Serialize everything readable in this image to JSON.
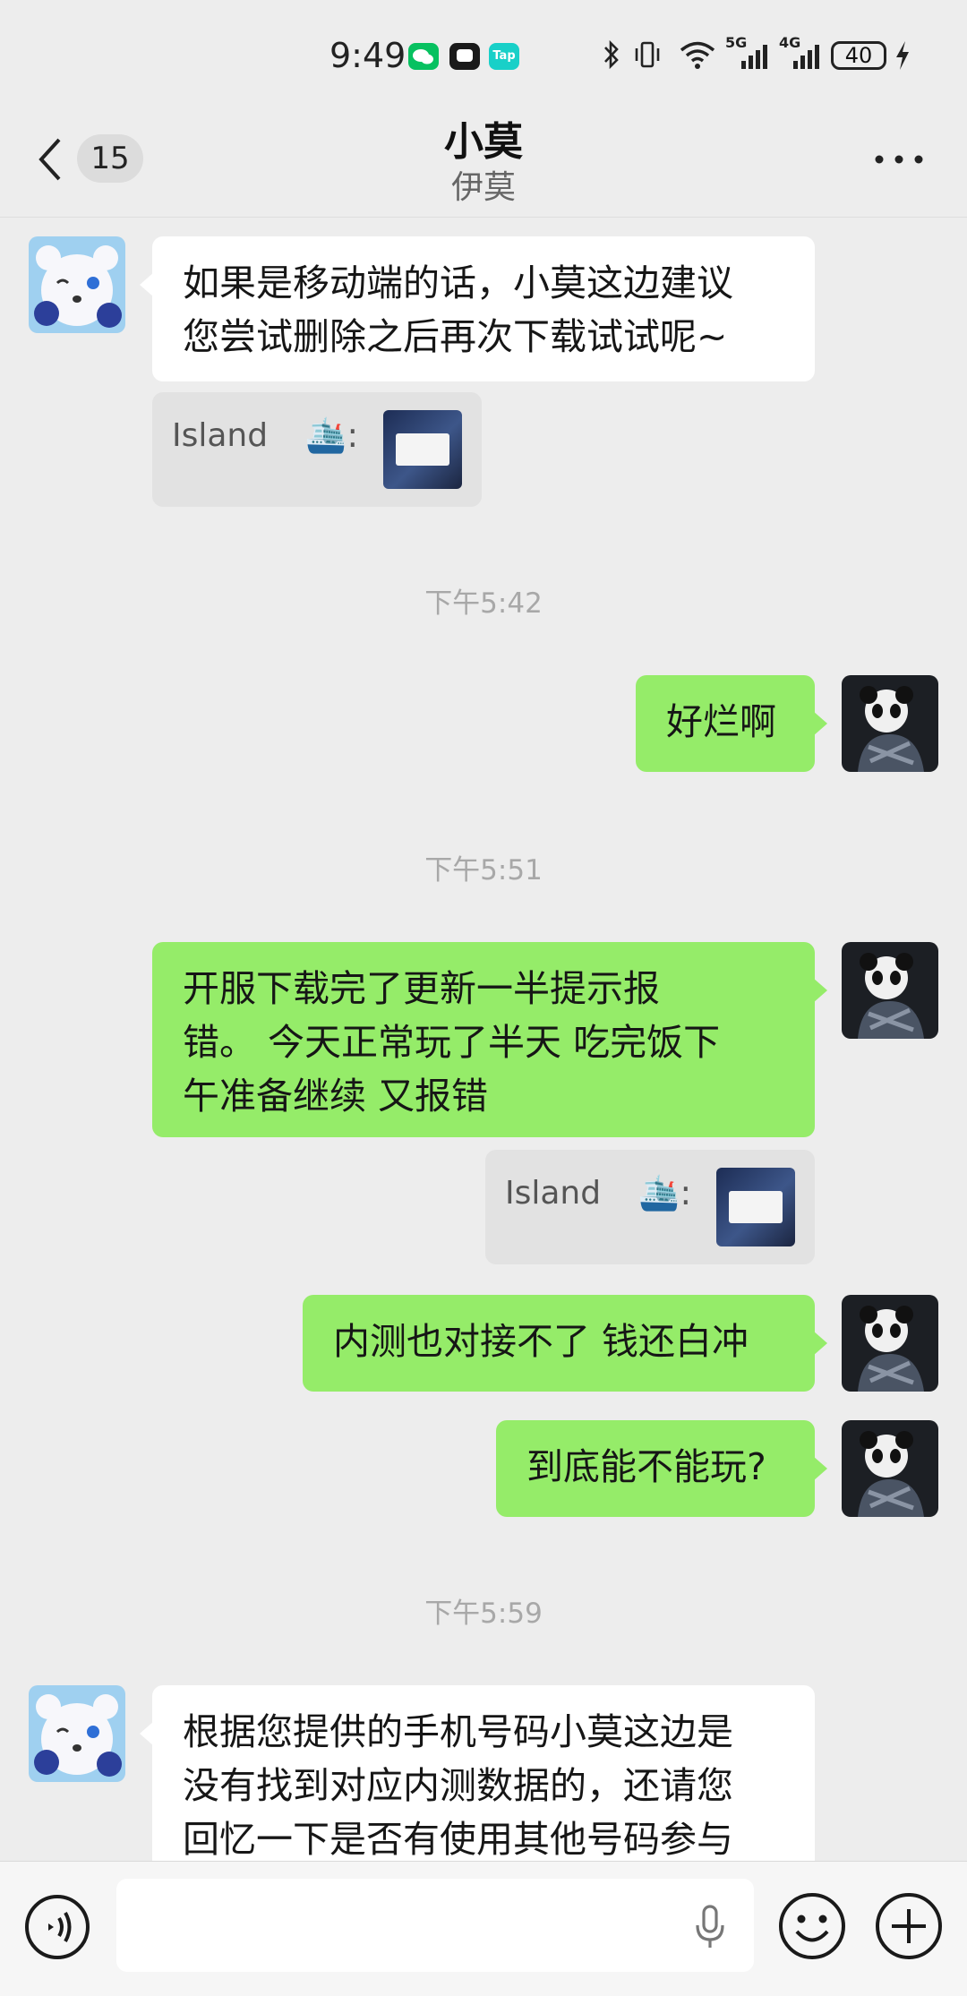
{
  "status_bar": {
    "time": "9:49",
    "app_icons": [
      "wechat-icon",
      "chat-app-icon",
      "taptap-icon"
    ],
    "taptap_label": "Tap",
    "network_5g": "5G",
    "network_4g": "4G",
    "battery": "40"
  },
  "header": {
    "unread_count": "15",
    "title": "小莫",
    "subtitle": "伊莫"
  },
  "messages": [
    {
      "side": "left",
      "text": "如果是移动端的话，小莫这边建议\n您尝试删除之后再次下载试试呢~"
    },
    {
      "side": "left",
      "quote_name": "Island",
      "quote_emoji": "🛳️:"
    },
    {
      "timestamp": "下午5:42"
    },
    {
      "side": "right",
      "text": "好烂啊"
    },
    {
      "timestamp": "下午5:51"
    },
    {
      "side": "right",
      "text": "开服下载完了更新一半提示报\n错。  今天正常玩了半天 吃完饭下\n午准备继续 又报错"
    },
    {
      "side": "right",
      "quote_name": "Island",
      "quote_emoji": "🛳️:"
    },
    {
      "side": "right",
      "text": "内测也对接不了 钱还白冲"
    },
    {
      "side": "right",
      "text": "到底能不能玩?"
    },
    {
      "timestamp": "下午5:59"
    },
    {
      "side": "left",
      "text": "根据您提供的手机号码小莫这边是\n没有找到对应内测数据的，还请您\n回忆一下是否有使用其他号码参与"
    }
  ],
  "colors": {
    "background": "#ededed",
    "self_bubble": "#95ec69",
    "other_bubble": "#ffffff",
    "timestamp": "#a8a8a8"
  }
}
